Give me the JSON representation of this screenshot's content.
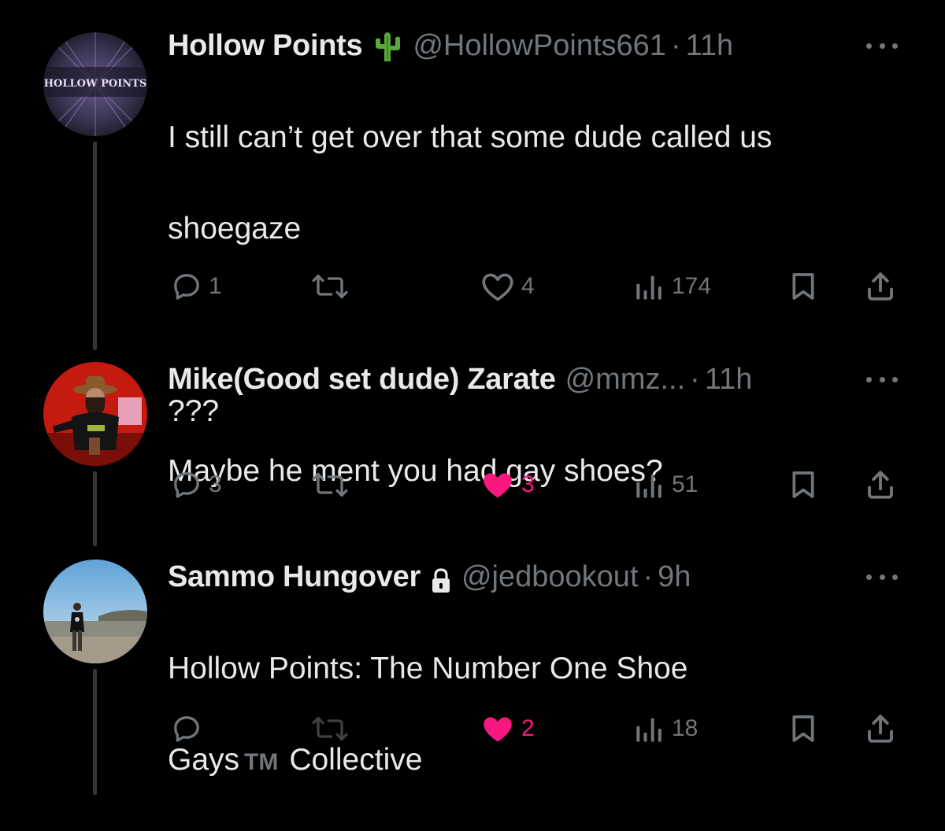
{
  "colors": {
    "background": "#000000",
    "text_primary": "#e7e9ea",
    "text_secondary": "#71767b",
    "like_active": "#f91880",
    "thread_line": "#333639"
  },
  "tweets": [
    {
      "name": "Hollow Points",
      "name_icon": "cactus-icon",
      "handle": "@HollowPoints661",
      "separator": "·",
      "time": "11h",
      "lines": [
        "I still can’t get over that some dude called us",
        "shoegaze",
        "",
        "???"
      ],
      "avatar_text": "HOLLOW POINTS",
      "actions": {
        "replies": "1",
        "reposts": "",
        "likes": "4",
        "liked": false,
        "views": "174"
      }
    },
    {
      "name": "Mike(Good set dude) Zarate",
      "handle": "@mmz...",
      "separator": "·",
      "time": "11h",
      "lines": [
        "Maybe he ment you had gay shoes?"
      ],
      "actions": {
        "replies": "3",
        "reposts": "",
        "likes": "3",
        "liked": true,
        "views": "51"
      }
    },
    {
      "name": "Sammo Hungover",
      "name_icon": "lock-icon",
      "handle": "@jedbookout",
      "separator": "·",
      "time": "9h",
      "line1": "Hollow Points: The Number One Shoe",
      "line2_a": "Gays",
      "line2_tm": "TM",
      "line2_b": "Collective",
      "actions": {
        "replies": "",
        "reposts": "",
        "likes": "2",
        "liked": true,
        "views": "18"
      }
    }
  ]
}
